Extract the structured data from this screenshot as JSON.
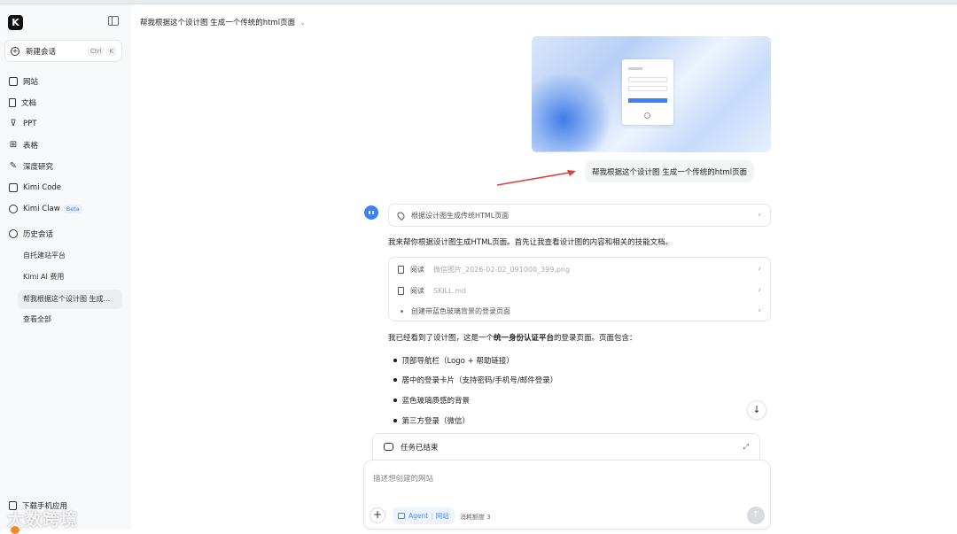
{
  "sidebar": {
    "logo": "K",
    "new_chat": {
      "label": "新建会话",
      "shortcut_mod": "Ctrl",
      "shortcut_key": "K"
    },
    "nav": [
      {
        "label": "网站",
        "icon": "website-icon"
      },
      {
        "label": "文档",
        "icon": "document-icon"
      },
      {
        "label": "PPT",
        "icon": "ppt-icon"
      },
      {
        "label": "表格",
        "icon": "table-icon"
      },
      {
        "label": "深度研究",
        "icon": "research-icon"
      },
      {
        "label": "Kimi Code",
        "icon": "code-icon"
      },
      {
        "label": "Kimi Claw",
        "icon": "claw-icon",
        "badge": "Beta"
      },
      {
        "label": "历史会话",
        "icon": "history-icon"
      }
    ],
    "history": [
      "自托建站平台",
      "Kimi AI 费用",
      "帮我根据这个设计图 生成...",
      "查看全部"
    ],
    "bottom_label": "下载手机应用",
    "watermark": "大数跨境"
  },
  "chat": {
    "title": "帮我根据这个设计图 生成一个传统的html页面",
    "user_message": "帮我根据这个设计图 生成一个传统的html页面",
    "plan_card": "根据设计图生成传统HTML页面",
    "intro": "我来帮你根据设计图生成HTML页面。首先让我查看设计图的内容和相关的技能文档。",
    "steps": [
      {
        "action": "阅读",
        "file": "微信图片_2026-02-02_091000_399.png"
      },
      {
        "action": "阅读",
        "file": "SKILL.md"
      },
      {
        "action": "创建带蓝色玻璃背景的登录页面",
        "file": ""
      }
    ],
    "summary_pre": "我已经看到了设计图，这是一个",
    "summary_bold": "统一身份认证平台",
    "summary_post": "的登录页面。页面包含：",
    "bullets": [
      "顶部导航栏（Logo + 帮助链接）",
      "居中的登录卡片（支持密码/手机号/邮件登录）",
      "蓝色玻璃质感的背景",
      "第三方登录（微信）"
    ]
  },
  "task_status": "任务已结束",
  "input": {
    "placeholder": "描述想创建的网站",
    "agent_label": "Agent",
    "mode_label": "网站",
    "credit": "消耗额度 3"
  },
  "colors": {
    "accent": "#3b82f6",
    "arrow": "#d9433a",
    "sidebar_bg": "#f7f8fa"
  }
}
